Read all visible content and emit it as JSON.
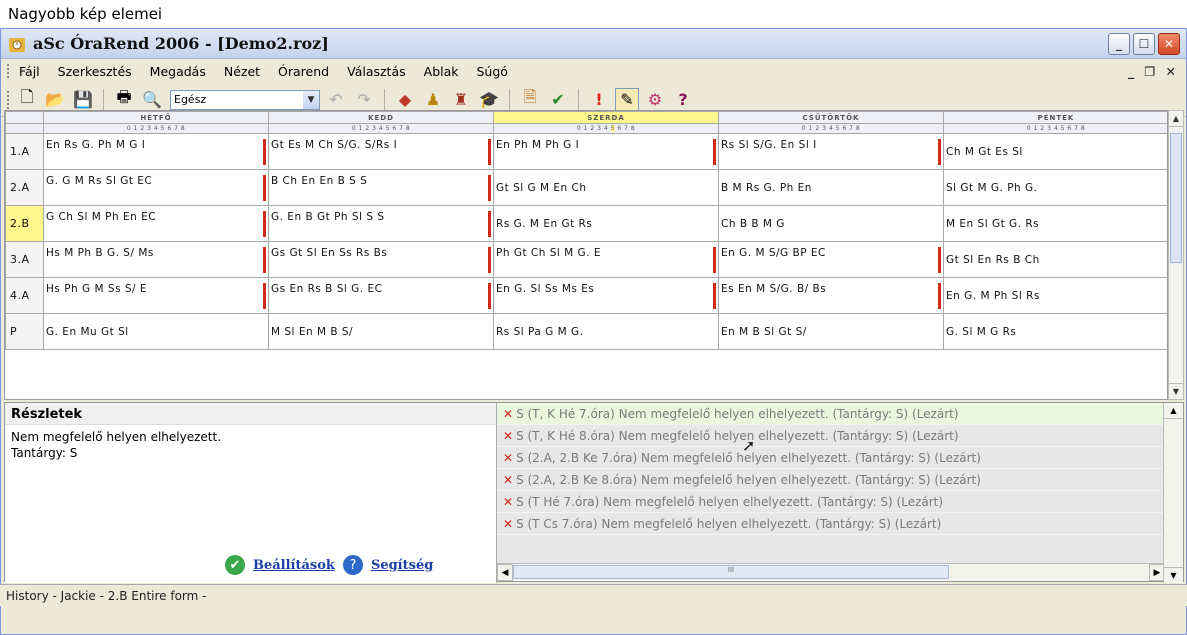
{
  "caption": "Nagyobb kép elemei",
  "window": {
    "title": "aSc ÓraRend 2006 - [Demo2.roz]"
  },
  "menu": [
    "Fájl",
    "Szerkesztés",
    "Megadás",
    "Nézet",
    "Órarend",
    "Választás",
    "Ablak",
    "Súgó"
  ],
  "toolbar": {
    "combo_value": "Egész"
  },
  "days": [
    "HÉTFŐ",
    "KEDD",
    "SZERDA",
    "CSÜTÖRTÖK",
    "PÉNTEK"
  ],
  "periods": [
    "0",
    "1",
    "2",
    "3",
    "4",
    "5",
    "6",
    "7",
    "8"
  ],
  "rows": [
    {
      "cls": "1.A",
      "d": [
        "En Rs G. Ph M G   I",
        "Gt Es M Ch S/G. S/Rs  I",
        "En Ph M Ph G   I",
        "Rs Sl S/G. En Sl  I",
        "Ch M Gt Es Sl"
      ]
    },
    {
      "cls": "2.A",
      "d": [
        "G. G M Rs Sl Gt  EC",
        "B Ch En En B S S",
        "Gt Sl G M En Ch",
        "B M Rs G. Ph En",
        "Sl Gt M G. Ph G."
      ]
    },
    {
      "cls": "2.B",
      "d": [
        "G Ch Sl M Ph En  EC",
        "G. En B Gt Ph Sl S S",
        "Rs G. M En Gt Rs",
        "Ch B B M G",
        "M En Sl Gt G. Rs"
      ]
    },
    {
      "cls": "3.A",
      "d": [
        "Hs  M Ph B G. S/  Ms",
        "Gs Gt Sl En Ss Rs  Bs",
        "Ph Gt Ch Sl M G.  E",
        "En G. M S/G  BP  EC",
        "Gt Sl En Rs B Ch"
      ]
    },
    {
      "cls": "4.A",
      "d": [
        "Hs  Ph G M Ss S/  E",
        "Gs En Rs B Sl G.  EC",
        "En G. Sl Ss Ms Es",
        "Es En M S/G. B/  Bs",
        "En G. M Ph Sl Rs"
      ]
    },
    {
      "cls": "P",
      "d": [
        "G. En Mu Gt Sl",
        "M Sl En M B S/",
        "Rs Sl Pa G M G.",
        "En M B Sl Gt S/",
        "G. Sl M G Rs"
      ]
    }
  ],
  "details": {
    "title": "Részletek",
    "line1": "Nem megfelelő helyen elhelyezett.",
    "line2": "Tantárgy: S",
    "settings": "Beállítások",
    "help": "Segítség"
  },
  "errors": [
    "S (T, K Hé 7.óra) Nem megfelelő helyen elhelyezett. (Tantárgy: S) (Lezárt)",
    "S (T, K Hé 8.óra) Nem megfelelő helyen elhelyezett. (Tantárgy: S) (Lezárt)",
    "S (2.A, 2.B Ke 7.óra) Nem megfelelő helyen elhelyezett. (Tantárgy: S) (Lezárt)",
    "S (2.A, 2.B Ke 8.óra) Nem megfelelő helyen elhelyezett. (Tantárgy: S) (Lezárt)",
    "S (T Hé 7.óra) Nem megfelelő helyen elhelyezett. (Tantárgy: S) (Lezárt)",
    "S (T Cs 7.óra) Nem megfelelő helyen elhelyezett. (Tantárgy: S) (Lezárt)"
  ],
  "scroll_mark": "III",
  "status": "History - Jackie - 2.B Entire form -"
}
